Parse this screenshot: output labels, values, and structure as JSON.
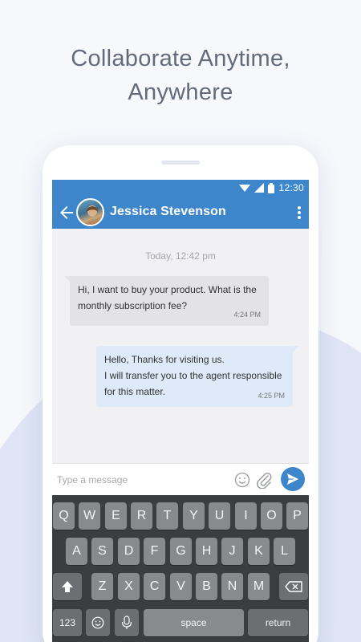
{
  "headline": {
    "line1": "Collaborate Anytime,",
    "line2": "Anywhere"
  },
  "status_bar": {
    "time": "12:30",
    "icons": [
      "wifi-icon",
      "signal-icon",
      "battery-icon"
    ]
  },
  "app_bar": {
    "contact_name": "Jessica Stevenson",
    "back_icon": "arrow-left-icon",
    "menu_icon": "more-vertical-icon"
  },
  "chat": {
    "date_label": "Today, 12:42 pm",
    "messages": [
      {
        "direction": "incoming",
        "lines": [
          "Hi, I want to buy your product. What is the",
          "monthly subscription fee?"
        ],
        "time": "4:24 PM"
      },
      {
        "direction": "outgoing",
        "lines": [
          "Hello, Thanks for visiting us.",
          "I will transfer you to the agent responsible",
          "for this matter."
        ],
        "time": "4:25 PM"
      }
    ]
  },
  "composer": {
    "placeholder": "Type a message",
    "value": "",
    "icons": [
      "emoji-icon",
      "paperclip-icon",
      "send-icon"
    ]
  },
  "keyboard": {
    "row1": [
      "Q",
      "W",
      "E",
      "R",
      "T",
      "Y",
      "U",
      "I",
      "O",
      "P"
    ],
    "row2": [
      "A",
      "S",
      "D",
      "F",
      "G",
      "H",
      "J",
      "K",
      "L"
    ],
    "row3": [
      "Z",
      "X",
      "C",
      "V",
      "B",
      "N",
      "M"
    ],
    "bottom": {
      "numbers": "123",
      "space": "space",
      "return": "return"
    }
  },
  "colors": {
    "accent": "#3d86cc",
    "background": "#f7f8fc",
    "headline": "#636b7a",
    "incoming_bubble": "#e3e3e5",
    "outgoing_bubble": "#deeaf8",
    "keyboard_bg": "#3c3d41",
    "key_bg": "#888a8e"
  }
}
